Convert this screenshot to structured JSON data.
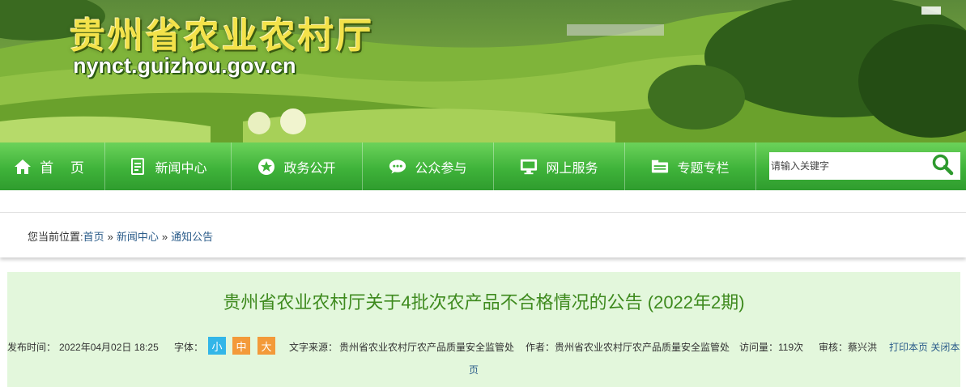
{
  "banner": {
    "site_title": "贵州省农业农村厅",
    "site_domain": "nynct.guizhou.gov.cn"
  },
  "nav": {
    "items": [
      {
        "label": "首 页",
        "icon": "home-icon"
      },
      {
        "label": "新闻中心",
        "icon": "document-icon"
      },
      {
        "label": "政务公开",
        "icon": "star-icon"
      },
      {
        "label": "公众参与",
        "icon": "chat-bubble-icon"
      },
      {
        "label": "网上服务",
        "icon": "monitor-icon"
      },
      {
        "label": "专题专栏",
        "icon": "folder-icon"
      }
    ],
    "search": {
      "placeholder": "请输入关键字",
      "icon": "search-icon"
    }
  },
  "breadcrumb": {
    "prefix": "您当前位置:",
    "items": [
      "首页",
      "新闻中心",
      "通知公告"
    ],
    "separator": "»"
  },
  "article": {
    "title": "贵州省农业农村厅关于4批次农产品不合格情况的公告 (2022年2期)",
    "meta": {
      "publish_label": "发布时间：",
      "publish_time": "2022年04月02日 18:25",
      "font_label": "字体：",
      "font_small": "小",
      "font_medium": "中",
      "font_large": "大",
      "source_label": "文字来源：",
      "source": "贵州省农业农村厅农产品质量安全监管处",
      "author_label": "作者：",
      "author": "贵州省农业农村厅农产品质量安全监管处",
      "views_label": "访问量：",
      "views": "119次",
      "reviewer_label": "审核：",
      "reviewer": "蔡兴洪",
      "print_link": "打印本页",
      "close_link_part1": "关闭本",
      "close_link_part2": "页"
    }
  },
  "colors": {
    "title_yellow": "#f3e24a",
    "nav_green": "#3fb33a",
    "article_bg": "#e3f7dc",
    "title_green": "#3e8a1e",
    "link_blue": "#2b5c8a",
    "font_small_bg": "#33b6e8",
    "font_mid_bg": "#f39a3a"
  }
}
